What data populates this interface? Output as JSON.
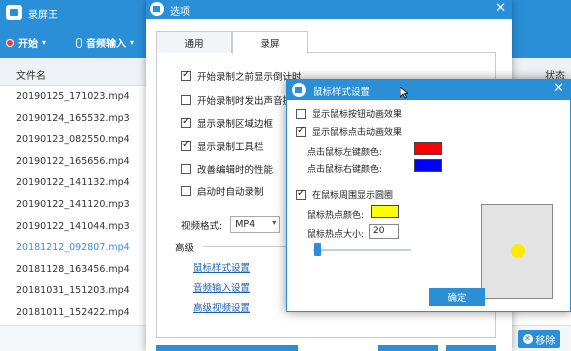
{
  "main": {
    "title": "录屏王",
    "toolbar": {
      "start_label": "开始",
      "audio_label": "音频输入"
    },
    "table": {
      "col_name": "文件名",
      "col_status": "状态",
      "rows": [
        "20190125_171023.mp4",
        "20190124_165532.mp3",
        "20190123_082550.mp4",
        "20190122_165656.mp4",
        "20190122_141132.mp4",
        "20190122_141120.mp3",
        "20190122_141044.mp3",
        "20181212_092807.mp4",
        "20181128_163456.mp4",
        "20181031_151203.mp4",
        "20181011_152422.mp4"
      ],
      "selected_row": 7
    },
    "remove_label": "移除"
  },
  "options": {
    "title": "选项",
    "tabs": [
      "通用",
      "录屏"
    ],
    "active_tab": 1,
    "checks": [
      {
        "label": "开始录制之前显示倒计时",
        "checked": true
      },
      {
        "label": "开始录制时发出声音提示",
        "checked": false
      },
      {
        "label": "显示录制区域边框",
        "checked": true
      },
      {
        "label": "显示录制工具栏",
        "checked": true
      },
      {
        "label": "改善编辑时的性能",
        "checked": false
      },
      {
        "label": "启动时自动录制",
        "checked": false
      }
    ],
    "format_label": "视频格式:",
    "format_value": "MP4",
    "advanced_label": "高级",
    "advanced_links": [
      "鼠标样式设置",
      "音频输入设置",
      "高级视频设置"
    ]
  },
  "mouse_dialog": {
    "title": "鼠标样式设置",
    "show_move_effect": {
      "label": "显示鼠标按钮动画效果",
      "checked": false
    },
    "show_click_effect": {
      "label": "显示鼠标点击动画效果",
      "checked": true
    },
    "left_color_label": "点击鼠标左键颜色:",
    "left_color": "#ff0000",
    "right_color_label": "点击鼠标右键颜色:",
    "right_color": "#0000ff",
    "show_circle": {
      "label": "在鼠标周围显示圆圈",
      "checked": true
    },
    "hotspot_color_label": "鼠标热点颜色:",
    "hotspot_color": "#ffff00",
    "hotspot_size_label": "鼠标热点大小:",
    "hotspot_size": "20",
    "ok_label": "确定"
  },
  "colors": {
    "accent": "#2a8fd7",
    "link": "#1a5fb4",
    "selected_row_text": "#3a8ee6"
  }
}
